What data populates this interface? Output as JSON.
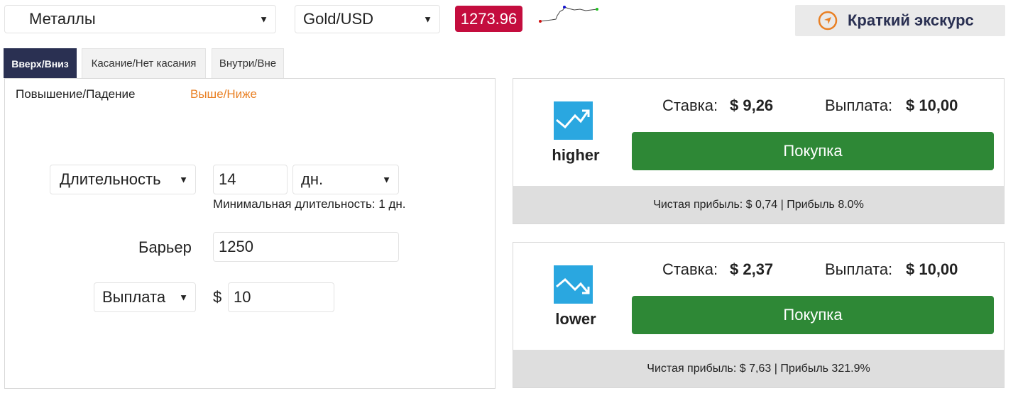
{
  "toolbar": {
    "market": "Металлы",
    "underlying": "Gold/USD",
    "spot_price": "1273.96",
    "tour_label": "Краткий экскурс"
  },
  "tabs": [
    {
      "label": "Вверх/Вниз",
      "active": true
    },
    {
      "label": "Касание/Нет касания",
      "active": false
    },
    {
      "label": "Внутри/Вне",
      "active": false
    }
  ],
  "subtabs": [
    {
      "label": "Повышение/Падение",
      "active": false
    },
    {
      "label": "Выше/Ниже",
      "active": true
    }
  ],
  "form": {
    "duration_type": "Длительность",
    "duration_amount": "14",
    "duration_unit": "дн.",
    "duration_hint": "Минимальная длительность: 1 дн.",
    "barrier_label": "Барьер",
    "barrier_value": "1250",
    "payout_type": "Выплата",
    "currency_sign": "$",
    "payout_amount": "10"
  },
  "contracts": [
    {
      "name": "higher",
      "stake_label": "Ставка:",
      "stake": "$ 9,26",
      "payout_label": "Выплата:",
      "payout": "$ 10,00",
      "buy_label": "Покупка",
      "footer": "Чистая прибыль: $ 0,74 | Прибыль 8.0%",
      "icon": "trend-up-icon"
    },
    {
      "name": "lower",
      "stake_label": "Ставка:",
      "stake": "$ 2,37",
      "payout_label": "Выплата:",
      "payout": "$ 10,00",
      "buy_label": "Покупка",
      "footer": "Чистая прибыль: $ 7,63 | Прибыль 321.9%",
      "icon": "trend-down-icon"
    }
  ],
  "colors": {
    "spot_bg": "#c40d3e",
    "active_tab": "#2a3052",
    "active_subtab": "#e98024",
    "buy_button": "#2e8836",
    "contract_icon": "#2aa7e0"
  }
}
